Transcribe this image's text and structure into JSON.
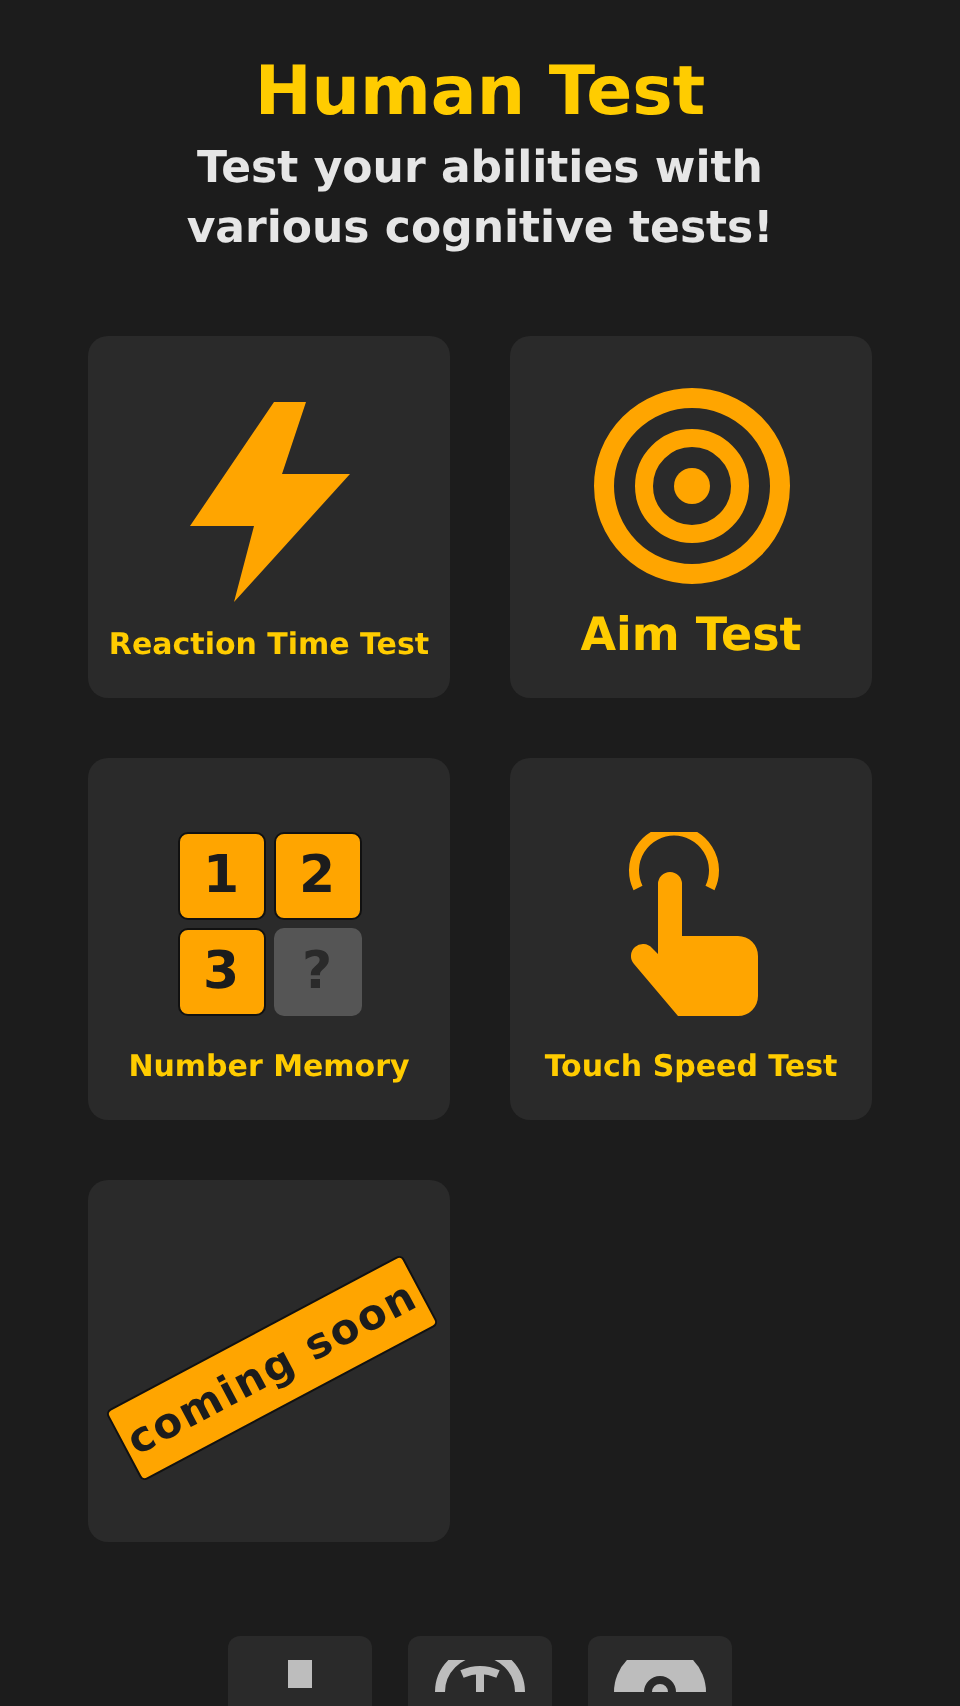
{
  "header": {
    "title": "Human Test",
    "subtitle": "Test your abilities with various cognitive tests!"
  },
  "tests": [
    {
      "kind": "bolt",
      "label": "Reaction Time Test"
    },
    {
      "kind": "target",
      "label": "Aim Test"
    },
    {
      "kind": "numbers",
      "label": "Number Memory",
      "cells": [
        {
          "text": "1",
          "hidden": false
        },
        {
          "text": "2",
          "hidden": false
        },
        {
          "text": "3",
          "hidden": false
        },
        {
          "text": "?",
          "hidden": true
        }
      ]
    },
    {
      "kind": "touch",
      "label": "Touch Speed Test"
    },
    {
      "kind": "coming_soon",
      "badge": "coming soon"
    }
  ],
  "bottom_bar": [
    {
      "kind": "stem"
    },
    {
      "kind": "globe"
    },
    {
      "kind": "circle"
    }
  ]
}
